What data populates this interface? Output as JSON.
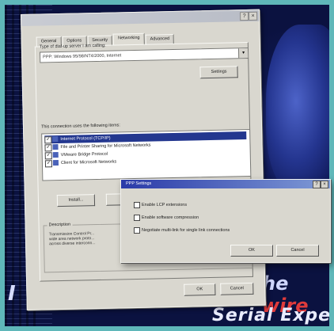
{
  "window": {
    "title": "",
    "help_glyph": "?",
    "close_glyph": "×"
  },
  "tabs": [
    {
      "label": "General"
    },
    {
      "label": "Options"
    },
    {
      "label": "Security"
    },
    {
      "label": "Networking",
      "active": true
    },
    {
      "label": "Advanced"
    }
  ],
  "networking": {
    "server_type_label": "Type of dial-up server I am calling:",
    "server_type_value": "PPP: Windows 95/98/NT4/2000, Internet",
    "settings_button": "Settings",
    "components_label": "This connection uses the following items:",
    "components": [
      {
        "label": "Internet Protocol (TCP/IP)",
        "checked": true,
        "selected": true
      },
      {
        "label": "File and Printer Sharing for Microsoft Networks",
        "checked": true,
        "selected": false
      },
      {
        "label": "VMware Bridge Protocol",
        "checked": true,
        "selected": false
      },
      {
        "label": "Client for Microsoft Networks",
        "checked": true,
        "selected": false
      }
    ],
    "install_button": "Install...",
    "description_legend": "Description",
    "description_text": "Transmission Control Pr... wide area network proto... across diverse interconn..."
  },
  "footer": {
    "ok_button": "OK",
    "cancel_button": "Cancel"
  },
  "ppp_dialog": {
    "title": "PPP Settings",
    "help_glyph": "?",
    "close_glyph": "×",
    "options": [
      {
        "label": "Enable LCP extensions",
        "checked": false
      },
      {
        "label": "Enable software compression",
        "checked": false
      },
      {
        "label": "Negotiate multi-link for single link connections",
        "checked": false
      }
    ],
    "ok_button": "OK",
    "cancel_button": "Cancel"
  },
  "background": {
    "text_left": "I",
    "text_right_pre": "he ",
    "text_right_red": "wire",
    "text_bottom": "Serial Experim"
  }
}
